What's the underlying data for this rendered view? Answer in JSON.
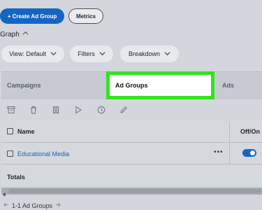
{
  "toolbar": {
    "create_label": "+ Create Ad Group",
    "metrics_label": "Metrics"
  },
  "graph": {
    "label": "Graph"
  },
  "filters": {
    "view_label": "View: Default",
    "filters_label": "Filters",
    "breakdown_label": "Breakdown"
  },
  "tabs": [
    {
      "label": "Campaigns"
    },
    {
      "label": "Ad Groups",
      "selected": true
    },
    {
      "label": "Ads"
    }
  ],
  "actions": [
    "archive-icon",
    "delete-icon",
    "pause-icon",
    "play-icon",
    "schedule-icon",
    "edit-icon"
  ],
  "table": {
    "headers": {
      "name": "Name",
      "status": "Off/On"
    },
    "rows": [
      {
        "name": "Educational Media",
        "more": "•••",
        "enabled": true
      }
    ],
    "totals_label": "Totals"
  },
  "pagination": {
    "label": "1-1 Ad Groups"
  },
  "colors": {
    "accent": "#1565c2",
    "highlight": "#33e31e"
  }
}
